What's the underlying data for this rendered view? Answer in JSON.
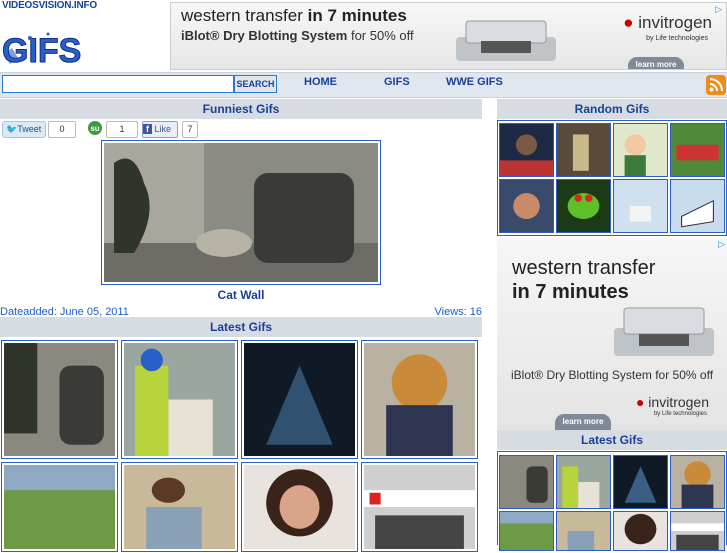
{
  "site": {
    "name": "VIDEOSVISION.INFO",
    "logo_text": "GIFS"
  },
  "top_ad": {
    "line1": "western transfer ",
    "line1_bold": "in 7 minutes",
    "line2_bold": "iBlot",
    "line2": " Dry Blotting System",
    "line2_tail": " for 50% off",
    "brand": "invitrogen",
    "by": "by Life technologies",
    "cta": "learn more"
  },
  "search": {
    "placeholder": "",
    "button_label": "SEARCH"
  },
  "nav": {
    "home": "HOME",
    "gifs": "GIFS",
    "wwe": "WWE GIFS"
  },
  "funniest": {
    "header": "Funniest Gifs",
    "tweet_label": "Tweet",
    "tweet_count": "0",
    "stumble_count": "1",
    "like_label": "Like",
    "like_count": "7",
    "title": "Cat Wall",
    "date": "Dateadded: June 05, 2011",
    "views": "Views: 16"
  },
  "latest": {
    "header": "Latest Gifs"
  },
  "random": {
    "header": "Random Gifs"
  },
  "right_latest": {
    "header": "Latest Gifs"
  },
  "right_ad": {
    "line1": "western transfer",
    "line2": "in 7 minutes",
    "line3": "iBlot® Dry Blotting System for 50% off",
    "brand": "invitrogen",
    "by": "by Life technologies",
    "cta": "learn more"
  },
  "colors": {
    "link": "#1a3f9a",
    "border": "#2a5ec9",
    "header_bg": "#d7dce2",
    "accent": "#2a7bd0"
  }
}
